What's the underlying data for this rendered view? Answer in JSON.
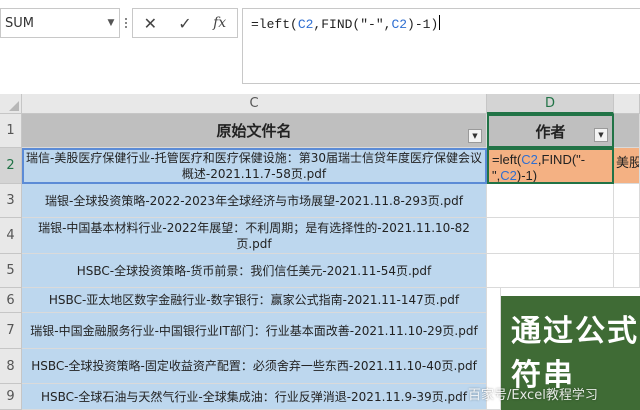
{
  "name_box": {
    "value": "SUM"
  },
  "formula_bar": {
    "fx_label": "fx",
    "formula": {
      "prefix": "=left(",
      "ref1": "C2",
      "mid": ",FIND(\"-\",",
      "ref2": "C2",
      "suffix": ")-1)"
    }
  },
  "columns": {
    "c": "C",
    "d": "D"
  },
  "rows": [
    "1",
    "2",
    "3",
    "4",
    "5",
    "6",
    "7",
    "8",
    "9"
  ],
  "sheet": {
    "header_c": "原始文件名",
    "header_d": "作者",
    "d2_formula": {
      "prefix": "=left(",
      "ref1": "C2",
      "mid": ",FIND(\"-\",",
      "ref2": "C2",
      "suffix": ")-1)"
    },
    "e2_text": "美股",
    "filenames": [
      "瑞信-美股医疗保健行业-托管医疗和医疗保健设施：第30届瑞士信贷年度医疗保健会议概述-2021.11.7-58页.pdf",
      "瑞银-全球投资策略-2022-2023年全球经济与市场展望-2021.11.8-293页.pdf",
      "瑞银-中国基本材料行业-2022年展望：不利周期；是有选择性的-2021.11.10-82页.pdf",
      "HSBC-全球投资策略-货币前景：我们信任美元-2021.11-54页.pdf",
      "HSBC-亚太地区数字金融行业-数字银行：赢家公式指南-2021.11-147页.pdf",
      "瑞银-中国金融服务行业-中国银行业IT部门：行业基本面改善-2021.11.10-29页.pdf",
      "HSBC-全球投资策略-固定收益资产配置：必须舍弃一些东西-2021.11.10-40页.pdf",
      "HSBC-全球石油与天然气行业-全球集成油：行业反弹消退-2021.11.9-39页.pdf"
    ]
  },
  "overlay": {
    "title": "通过公式\n符串"
  },
  "watermark": "百家号/Excel教程学习",
  "colors": {
    "header_gray": "#bfbfbf",
    "cell_blue": "#bdd7ee",
    "cell_orange": "#f4b183",
    "excel_green": "#217346",
    "overlay_green": "#3f6b35"
  }
}
